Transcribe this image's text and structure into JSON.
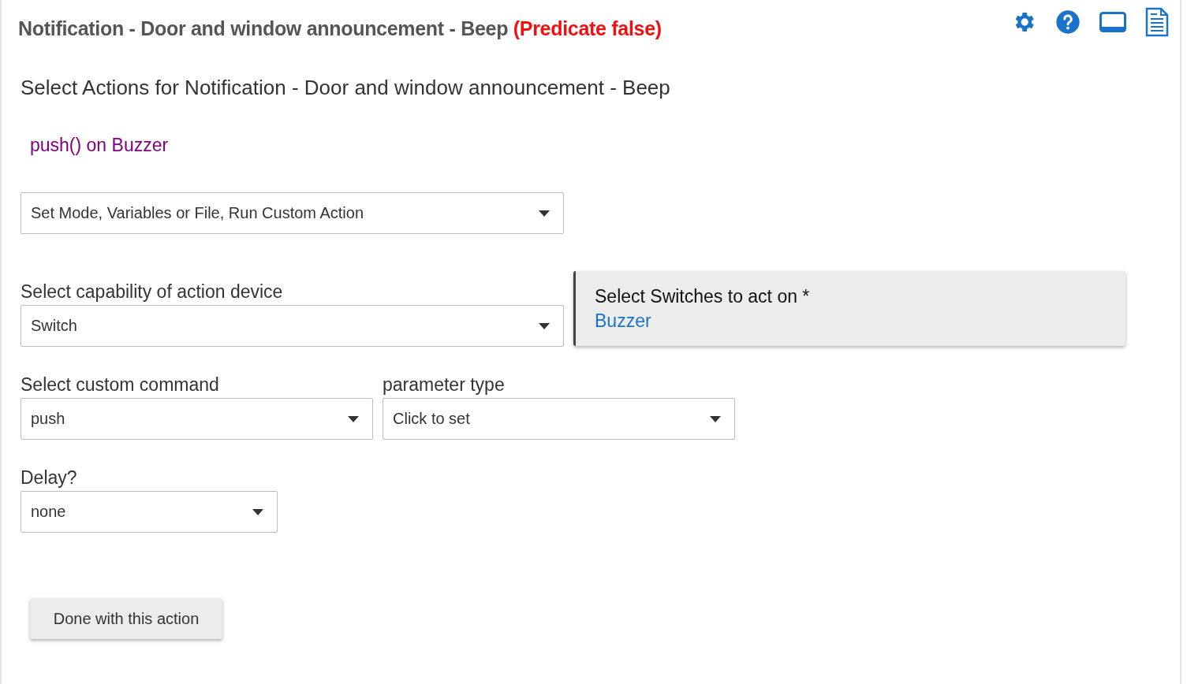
{
  "header": {
    "title": "Notification - Door and window announcement - Beep",
    "status": "(Predicate false)"
  },
  "heading": "Select Actions for Notification - Door and window announcement - Beep",
  "action_summary": "push() on Buzzer",
  "action_type": {
    "value": "Set Mode, Variables or File, Run Custom Action"
  },
  "capability": {
    "label": "Select capability of action device",
    "value": "Switch"
  },
  "device_card": {
    "label": "Select Switches to act on *",
    "value": "Buzzer"
  },
  "custom_command": {
    "label": "Select custom command",
    "value": "push"
  },
  "parameter_type": {
    "label": "parameter type",
    "value": "Click to set"
  },
  "delay": {
    "label": "Delay?",
    "value": "none"
  },
  "done_button": "Done with this action"
}
